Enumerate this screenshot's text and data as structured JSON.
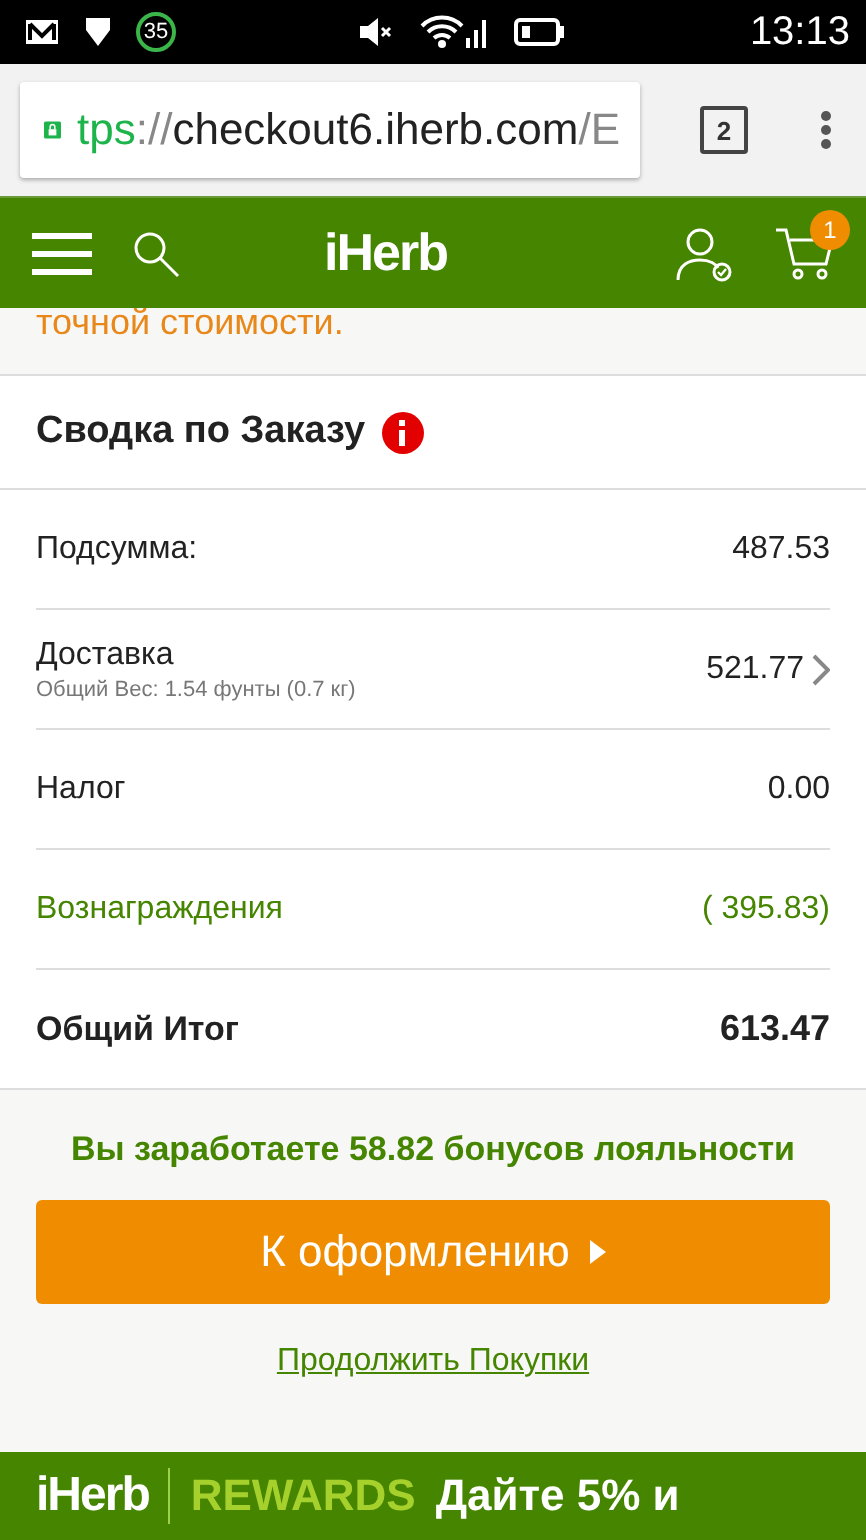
{
  "status_bar": {
    "badge": "35",
    "time": "13:13"
  },
  "browser": {
    "scheme": "tps",
    "separator": "://",
    "host": "checkout6.iherb.com",
    "path": "/E",
    "tab_count": "2"
  },
  "nav": {
    "logo": "iHerb",
    "cart_count": "1"
  },
  "notice": "точной стоимости.",
  "summary": {
    "title": "Сводка по Заказу",
    "rows": [
      {
        "kind": "plain",
        "label": "Подсумма:",
        "value": "487.53"
      },
      {
        "kind": "link",
        "label": "Доставка",
        "sublabel": "Общий Вес: 1.54 фунты (0.7 кг)",
        "value": "521.77"
      },
      {
        "kind": "plain",
        "label": "Налог",
        "value": "0.00"
      },
      {
        "kind": "reward",
        "label": "Вознаграждения",
        "value": "( 395.83)"
      },
      {
        "kind": "total",
        "label": "Общий Итог",
        "value": "613.47"
      }
    ]
  },
  "earn": "Вы заработаете  58.82 бонусов лояльности",
  "checkout_button": "К оформлению",
  "continue_link": "Продолжить Покупки",
  "banner": {
    "logo": "iHerb",
    "program": "REWARDS",
    "text": "Дайте 5% и"
  }
}
